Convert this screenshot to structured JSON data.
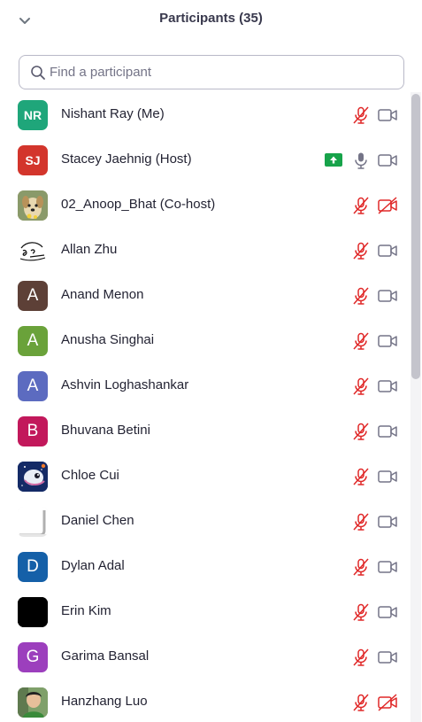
{
  "panel": {
    "title": "Participants (35)",
    "collapse_icon": "chevron-down-icon"
  },
  "search": {
    "placeholder": "Find a participant",
    "value": ""
  },
  "colors": {
    "muted_red": "#e02828",
    "icon_gray": "#747487",
    "share_green": "#17a34a"
  },
  "participants": [
    {
      "name": "Nishant Ray (Me)",
      "initials": "NR",
      "avatar_color": "#1fa67a",
      "avatar_kind": "initials",
      "mic": "muted",
      "video": "on"
    },
    {
      "name": "Stacey Jaehnig (Host)",
      "initials": "SJ",
      "avatar_color": "#d3352c",
      "avatar_kind": "initials",
      "mic": "unmuted",
      "video": "on",
      "sharing": true
    },
    {
      "name": "02_Anoop_Bhat (Co-host)",
      "initials": "",
      "avatar_color": "#b9a57a",
      "avatar_kind": "photo-dog",
      "mic": "muted",
      "video": "off"
    },
    {
      "name": "Allan Zhu",
      "initials": "",
      "avatar_color": "#ffffff",
      "avatar_kind": "sketch",
      "mic": "muted",
      "video": "on"
    },
    {
      "name": "Anand Menon",
      "initials": "A",
      "avatar_color": "#5d4037",
      "avatar_kind": "initials",
      "mic": "muted",
      "video": "on"
    },
    {
      "name": "Anusha Singhai",
      "initials": "A",
      "avatar_color": "#6aa23a",
      "avatar_kind": "initials",
      "mic": "muted",
      "video": "on"
    },
    {
      "name": "Ashvin Loghashankar",
      "initials": "A",
      "avatar_color": "#5c6bc0",
      "avatar_kind": "initials",
      "mic": "muted",
      "video": "on"
    },
    {
      "name": "Bhuvana Betini",
      "initials": "B",
      "avatar_color": "#c2185b",
      "avatar_kind": "initials",
      "mic": "muted",
      "video": "on"
    },
    {
      "name": "Chloe Cui",
      "initials": "",
      "avatar_color": "#1a3a7a",
      "avatar_kind": "photo-space",
      "mic": "muted",
      "video": "on"
    },
    {
      "name": "Daniel Chen",
      "initials": "",
      "avatar_color": "#f2f2f2",
      "avatar_kind": "photo-blank",
      "mic": "muted",
      "video": "on"
    },
    {
      "name": "Dylan Adal",
      "initials": "D",
      "avatar_color": "#1560a8",
      "avatar_kind": "initials",
      "mic": "muted",
      "video": "on"
    },
    {
      "name": "Erin Kim",
      "initials": "",
      "avatar_color": "#000000",
      "avatar_kind": "photo-black",
      "mic": "muted",
      "video": "on"
    },
    {
      "name": "Garima Bansal",
      "initials": "G",
      "avatar_color": "#9c3fbd",
      "avatar_kind": "initials",
      "mic": "muted",
      "video": "on"
    },
    {
      "name": "Hanzhang Luo",
      "initials": "",
      "avatar_color": "#6e8f5a",
      "avatar_kind": "photo-person",
      "mic": "muted",
      "video": "off"
    }
  ]
}
